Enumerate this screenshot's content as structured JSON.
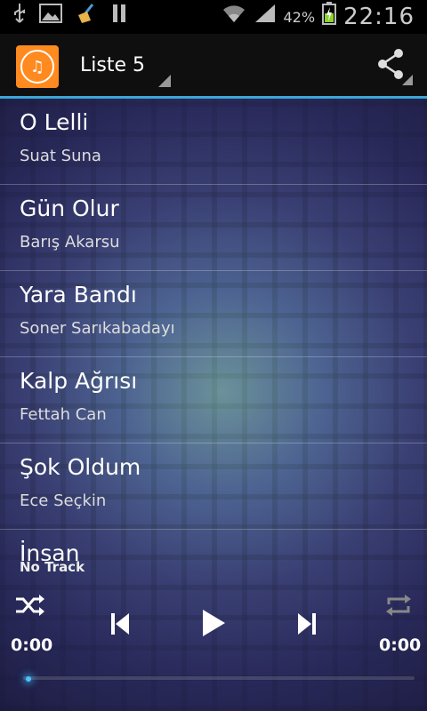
{
  "status_bar": {
    "battery_percent": "42%",
    "time": "22:16",
    "icons": [
      "usb-icon",
      "image-icon",
      "broom-icon",
      "pause-icon",
      "wifi-icon",
      "signal-icon",
      "battery-charging-icon"
    ]
  },
  "app_bar": {
    "title": "Liste 5",
    "logo_icon": "music-note-icon",
    "share_icon": "share-icon",
    "accent_color": "#3aa7d6"
  },
  "songs": [
    {
      "title": "O Lelli",
      "artist": "Suat Suna"
    },
    {
      "title": "Gün Olur",
      "artist": "Barış Akarsu"
    },
    {
      "title": "Yara Bandı",
      "artist": "Soner Sarıkabadayı"
    },
    {
      "title": "Kalp Ağrısı",
      "artist": "Fettah Can"
    },
    {
      "title": "Şok Oldum",
      "artist": "Ece Seçkin"
    },
    {
      "title": "İnsan",
      "artist": ""
    }
  ],
  "player": {
    "now_playing": "No Track",
    "elapsed": "0:00",
    "duration": "0:00",
    "progress": 0,
    "controls": [
      "shuffle-icon",
      "previous-icon",
      "play-icon",
      "next-icon",
      "repeat-icon"
    ]
  }
}
